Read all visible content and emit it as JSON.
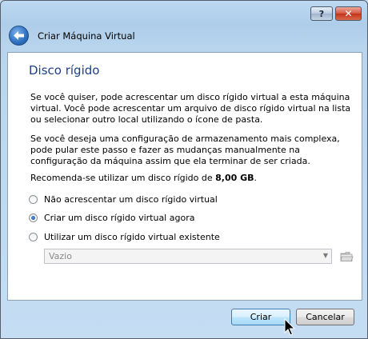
{
  "window": {
    "help_label": "?",
    "close_label": "✕",
    "title": "Criar Máquina Virtual"
  },
  "page": {
    "heading": "Disco rígido",
    "paragraph1": "Se você quiser, pode acrescentar um disco rígido virtual a esta máquina virtual. Você pode acrescentar um arquivo de disco rígido virtual na lista ou selecionar outro local utilizando o ícone de pasta.",
    "paragraph2": "Se você deseja uma configuração de armazenamento mais complexa, pode pular este passo e fazer as mudanças manualmente na configuração da máquina assim que ela terminar de ser criada.",
    "recommend_prefix": "Recomenda-se utilizar um disco rígido de ",
    "recommend_size": "8,00 GB",
    "recommend_suffix": "."
  },
  "options": [
    {
      "label": "Não acrescentar um disco rígido virtual",
      "checked": false
    },
    {
      "label": "Criar um disco rígido virtual agora",
      "checked": true
    },
    {
      "label": "Utilizar um disco rígido virtual existente",
      "checked": false
    }
  ],
  "existing_disk_select": {
    "value": "Vazio",
    "enabled": false
  },
  "icons": {
    "back": "back-arrow-icon",
    "folder": "folder-icon",
    "dropdown": "chevron-down-icon",
    "cursor": "mouse-pointer-icon"
  },
  "buttons": {
    "create": "Criar",
    "cancel": "Cancelar"
  },
  "colors": {
    "heading": "#1e3f8a",
    "close_button": "#c2331b",
    "default_button_border": "#3c7fb1"
  }
}
